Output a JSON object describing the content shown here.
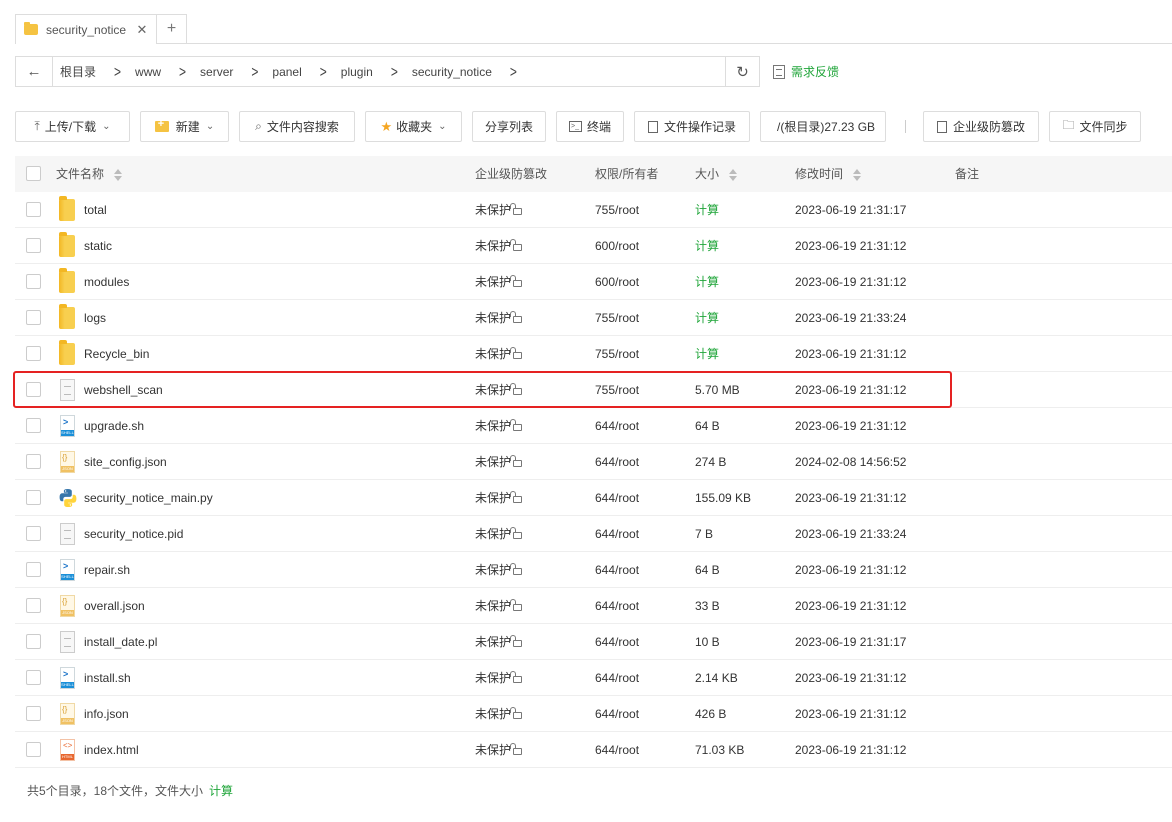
{
  "tabs": [
    {
      "label": "security_notice",
      "close": "✕"
    }
  ],
  "tab_add": "+",
  "breadcrumb": {
    "back": "←",
    "items": [
      "根目录",
      "www",
      "server",
      "panel",
      "plugin",
      "security_notice"
    ],
    "separator": ">",
    "refresh": "↻"
  },
  "feedback": "需求反馈",
  "toolbar": {
    "upload": "上传/下载",
    "new": "新建",
    "search": "文件内容搜索",
    "favorites": "收藏夹",
    "share_list": "分享列表",
    "terminal": "终端",
    "ops_log": "文件操作记录",
    "disk": "/(根目录)27.23 GB",
    "tamper": "企业级防篡改",
    "sync": "文件同步"
  },
  "columns": {
    "name": "文件名称",
    "tamper": "企业级防篡改",
    "perm": "权限/所有者",
    "size": "大小",
    "mtime": "修改时间",
    "note": "备注"
  },
  "files": [
    {
      "name": "total",
      "type": "folder",
      "tamper": "未保护",
      "perm": "755/root",
      "size": "计算",
      "mtime": "2023-06-19 21:31:17"
    },
    {
      "name": "static",
      "type": "folder",
      "tamper": "未保护",
      "perm": "600/root",
      "size": "计算",
      "mtime": "2023-06-19 21:31:12"
    },
    {
      "name": "modules",
      "type": "folder",
      "tamper": "未保护",
      "perm": "600/root",
      "size": "计算",
      "mtime": "2023-06-19 21:31:12"
    },
    {
      "name": "logs",
      "type": "folder",
      "tamper": "未保护",
      "perm": "755/root",
      "size": "计算",
      "mtime": "2023-06-19 21:33:24"
    },
    {
      "name": "Recycle_bin",
      "type": "folder",
      "tamper": "未保护",
      "perm": "755/root",
      "size": "计算",
      "mtime": "2023-06-19 21:31:12"
    },
    {
      "name": "webshell_scan",
      "type": "file",
      "tamper": "未保护",
      "perm": "755/root",
      "size": "5.70 MB",
      "mtime": "2023-06-19 21:31:12"
    },
    {
      "name": "upgrade.sh",
      "type": "shell",
      "tamper": "未保护",
      "perm": "644/root",
      "size": "64 B",
      "mtime": "2023-06-19 21:31:12"
    },
    {
      "name": "site_config.json",
      "type": "json",
      "tamper": "未保护",
      "perm": "644/root",
      "size": "274 B",
      "mtime": "2024-02-08 14:56:52"
    },
    {
      "name": "security_notice_main.py",
      "type": "python",
      "tamper": "未保护",
      "perm": "644/root",
      "size": "155.09 KB",
      "mtime": "2023-06-19 21:31:12"
    },
    {
      "name": "security_notice.pid",
      "type": "file",
      "tamper": "未保护",
      "perm": "644/root",
      "size": "7 B",
      "mtime": "2023-06-19 21:33:24"
    },
    {
      "name": "repair.sh",
      "type": "shell",
      "tamper": "未保护",
      "perm": "644/root",
      "size": "64 B",
      "mtime": "2023-06-19 21:31:12"
    },
    {
      "name": "overall.json",
      "type": "json",
      "tamper": "未保护",
      "perm": "644/root",
      "size": "33 B",
      "mtime": "2023-06-19 21:31:12"
    },
    {
      "name": "install_date.pl",
      "type": "file",
      "tamper": "未保护",
      "perm": "644/root",
      "size": "10 B",
      "mtime": "2023-06-19 21:31:17"
    },
    {
      "name": "install.sh",
      "type": "shell",
      "tamper": "未保护",
      "perm": "644/root",
      "size": "2.14 KB",
      "mtime": "2023-06-19 21:31:12"
    },
    {
      "name": "info.json",
      "type": "json",
      "tamper": "未保护",
      "perm": "644/root",
      "size": "426 B",
      "mtime": "2023-06-19 21:31:12"
    },
    {
      "name": "index.html",
      "type": "html",
      "tamper": "未保护",
      "perm": "644/root",
      "size": "71.03 KB",
      "mtime": "2023-06-19 21:31:12"
    }
  ],
  "highlighted_row": "webshell_scan",
  "footer": {
    "summary": "共5个目录，18个文件，文件大小",
    "calc": "计算"
  },
  "colors": {
    "accent_green": "#20a53a",
    "highlight_red": "#e52222",
    "folder_yellow": "#f8cf4f"
  }
}
